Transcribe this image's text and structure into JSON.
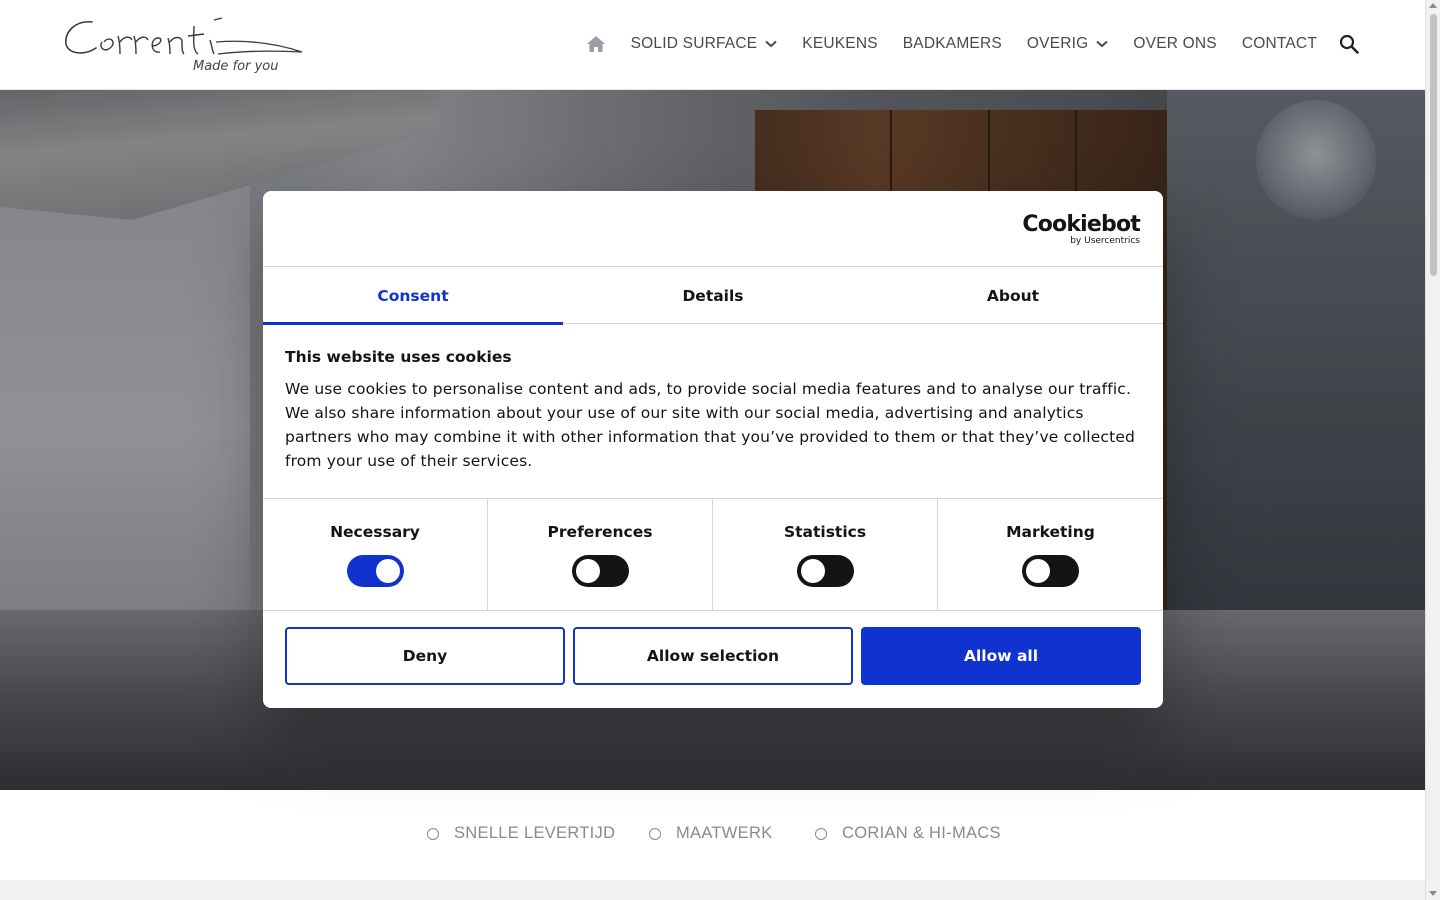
{
  "header": {
    "logo_text": "Correnti",
    "logo_tagline": "Made for you",
    "nav": {
      "home_icon": "home-icon",
      "items": [
        {
          "label": "SOLID SURFACE",
          "has_dropdown": true
        },
        {
          "label": "KEUKENS",
          "has_dropdown": false
        },
        {
          "label": "BADKAMERS",
          "has_dropdown": false
        },
        {
          "label": "OVERIG",
          "has_dropdown": true
        },
        {
          "label": "OVER ONS",
          "has_dropdown": false
        },
        {
          "label": "CONTACT",
          "has_dropdown": false
        }
      ],
      "search_icon": "search-icon"
    }
  },
  "features": [
    {
      "label": "SNELLE LEVERTIJD"
    },
    {
      "label": "MAATWERK"
    },
    {
      "label": "CORIAN & HI-MACS"
    }
  ],
  "cookie_dialog": {
    "brand": "Cookiebot",
    "brand_sub": "by Usercentrics",
    "tabs": [
      {
        "label": "Consent",
        "active": true
      },
      {
        "label": "Details",
        "active": false
      },
      {
        "label": "About",
        "active": false
      }
    ],
    "title": "This website uses cookies",
    "text": "We use cookies to personalise content and ads, to provide social media features and to analyse our traffic. We also share information about your use of our site with our social media, advertising and analytics partners who may combine it with other information that you’ve provided to them or that they’ve collected from your use of their services.",
    "toggles": [
      {
        "label": "Necessary",
        "on": true
      },
      {
        "label": "Preferences",
        "on": false
      },
      {
        "label": "Statistics",
        "on": false
      },
      {
        "label": "Marketing",
        "on": false
      }
    ],
    "buttons": {
      "deny": "Deny",
      "allow_selection": "Allow selection",
      "allow_all": "Allow all"
    }
  },
  "colors": {
    "accent": "#1032cf",
    "text_dark": "#141414",
    "nav_text": "#4a4a4a",
    "feature_text": "#8a8a8a"
  }
}
